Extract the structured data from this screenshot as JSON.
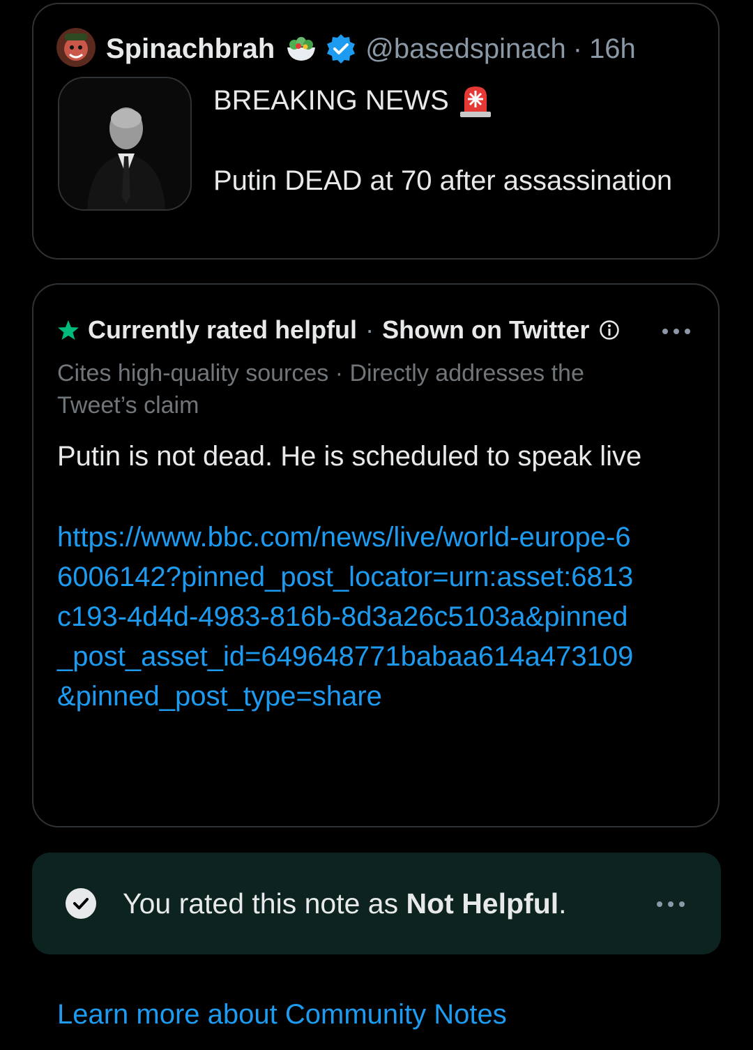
{
  "tweet": {
    "display_name": "Spinachbrah",
    "name_emoji": "salad-icon",
    "verified_icon": "verified-badge-icon",
    "handle": "@basedspinach",
    "separator": "·",
    "time": "16h",
    "headline": "BREAKING NEWS",
    "headline_emoji": "siren-icon",
    "body": "Putin DEAD at 70 after assassination"
  },
  "community_note": {
    "status_icon": "star-icon",
    "status": "Currently rated helpful",
    "separator": "·",
    "shown_on": "Shown on Twitter",
    "info_icon": "info-icon",
    "more_icon": "more-icon",
    "reasons": "Cites high-quality sources · Directly addresses the Tweet’s claim",
    "body": "Putin is not dead. He is scheduled to speak live",
    "link": "https://www.bbc.com/news/live/world-europe-66006142?pinned_post_locator=urn:asset:6813c193-4d4d-4983-816b-8d3a26c5103a&pinned_post_asset_id=649648771babaa614a473109&pinned_post_type=share"
  },
  "rating": {
    "icon": "check-circle-icon",
    "prefix": "You rated this note as ",
    "value": "Not Helpful",
    "suffix": ".",
    "more_icon": "more-icon"
  },
  "footer": {
    "learn_more": "Learn more about Community Notes"
  },
  "colors": {
    "background": "#000000",
    "text": "#e7e9ea",
    "muted": "#71767b",
    "link": "#1d9bf0",
    "star": "#00ba7c",
    "rating_bg": "#0c2320",
    "border": "#2f3336"
  }
}
